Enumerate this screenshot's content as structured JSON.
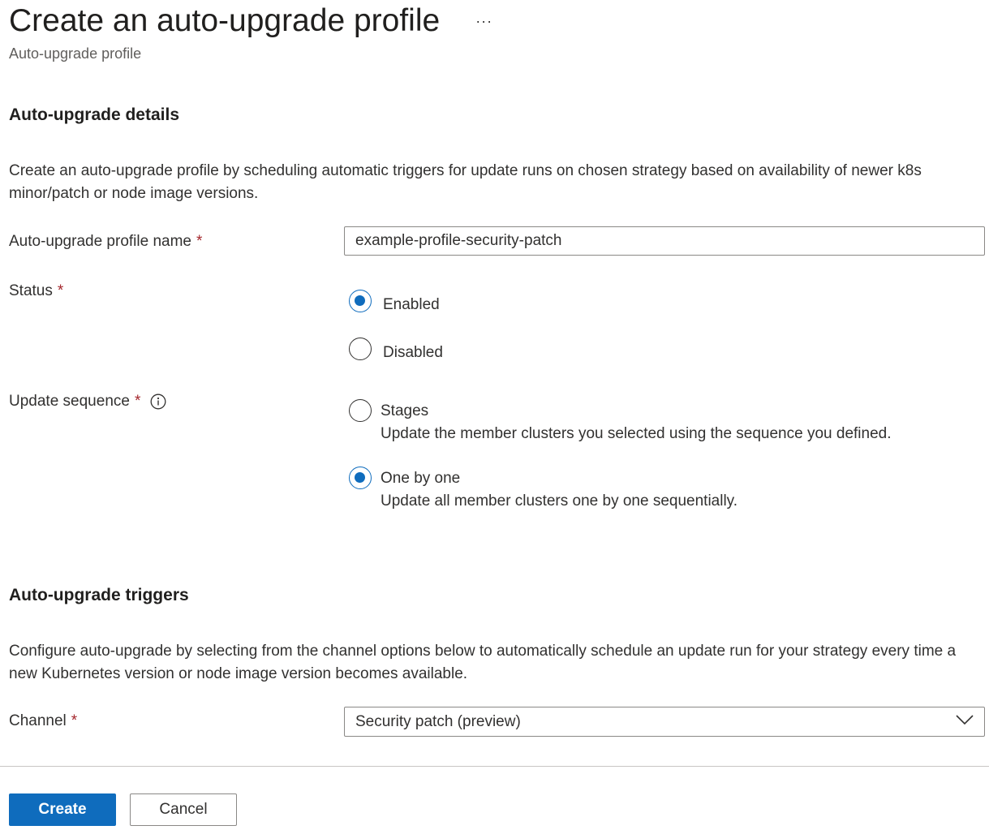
{
  "header": {
    "title": "Create an auto-upgrade profile",
    "more_label": "···",
    "subtitle": "Auto-upgrade profile"
  },
  "details": {
    "heading": "Auto-upgrade details",
    "description": "Create an auto-upgrade profile by scheduling automatic triggers for update runs on chosen strategy based on availability of newer k8s minor/patch or node image versions."
  },
  "fields": {
    "required_marker": "*",
    "profile_name": {
      "label": "Auto-upgrade profile name",
      "value": "example-profile-security-patch"
    },
    "status": {
      "label": "Status",
      "options": [
        {
          "label": "Enabled",
          "checked": true
        },
        {
          "label": "Disabled",
          "checked": false
        }
      ]
    },
    "update_sequence": {
      "label": "Update sequence",
      "options": [
        {
          "label": "Stages",
          "description": "Update the member clusters you selected using the sequence you defined.",
          "checked": false
        },
        {
          "label": "One by one",
          "description": "Update all member clusters one by one sequentially.",
          "checked": true
        }
      ]
    }
  },
  "triggers": {
    "heading": "Auto-upgrade triggers",
    "description": "Configure auto-upgrade by selecting from the channel options below to automatically schedule an update run for your strategy every time a new Kubernetes version or node image version becomes available.",
    "channel": {
      "label": "Channel",
      "value": "Security patch (preview)"
    }
  },
  "footer": {
    "create_label": "Create",
    "cancel_label": "Cancel"
  },
  "colors": {
    "accent": "#0f6cbd",
    "required": "#a4262c",
    "text": "#323130",
    "border": "#8a8886"
  },
  "icons": {
    "info": "info-icon",
    "chevron": "chevron-down-icon",
    "more": "more-icon"
  }
}
